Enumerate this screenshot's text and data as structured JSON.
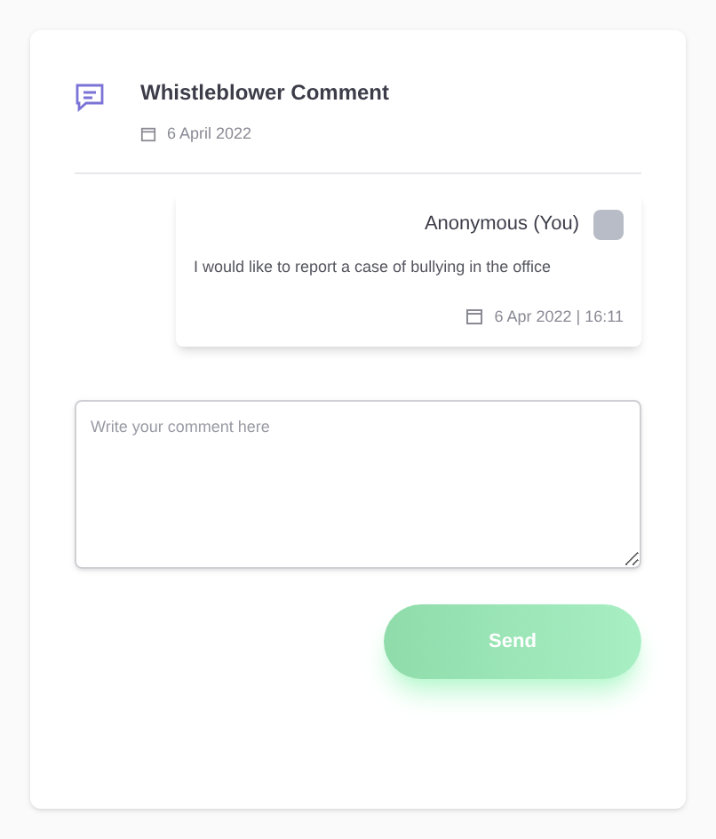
{
  "header": {
    "title": "Whistleblower Comment",
    "date": "6 April 2022"
  },
  "comments": [
    {
      "author": "Anonymous (You)",
      "text": "I would like to report a case of bullying in the office",
      "timestamp": "6 Apr 2022 | 16:11"
    }
  ],
  "comment_field": {
    "placeholder": "Write your comment here"
  },
  "send_button": {
    "label": "Send",
    "disabled": true
  }
}
